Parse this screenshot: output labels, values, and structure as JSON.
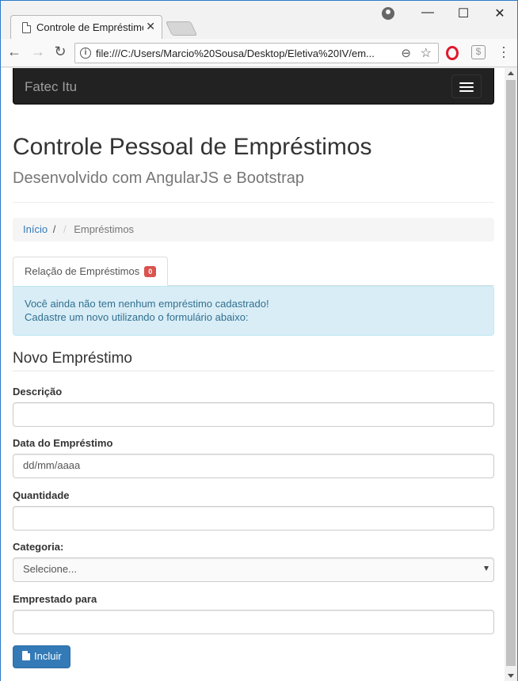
{
  "browser": {
    "tab_title": "Controle de Empréstimos",
    "tab_close": "✕",
    "url": "file:///C:/Users/Marcio%20Sousa/Desktop/Eletiva%20IV/em...",
    "controls": {
      "minimize": "—",
      "maximize": "☐",
      "close": "✕"
    }
  },
  "navbar": {
    "brand": "Fatec Itu"
  },
  "header": {
    "title": "Controle Pessoal de Empréstimos",
    "subtitle": "Desenvolvido com AngularJS e Bootstrap"
  },
  "breadcrumb": {
    "home": "Início",
    "separator": "/",
    "current": "Empréstimos"
  },
  "tabs": [
    {
      "label": "Relação de Empréstimos",
      "badge": "0"
    }
  ],
  "alert": {
    "line1": "Você ainda não tem nenhum empréstimo cadastrado!",
    "line2": "Cadastre um novo utilizando o formulário abaixo:"
  },
  "form": {
    "title": "Novo Empréstimo",
    "fields": {
      "descricao": {
        "label": "Descrição",
        "value": ""
      },
      "data": {
        "label": "Data do Empréstimo",
        "value": "dd/mm/aaaa"
      },
      "quantidade": {
        "label": "Quantidade",
        "value": ""
      },
      "categoria": {
        "label": "Categoria:",
        "selected": "Selecione..."
      },
      "emprestado_para": {
        "label": "Emprestado para",
        "value": ""
      }
    },
    "submit_label": "Incluir"
  },
  "colors": {
    "navbar": "#222222",
    "link": "#337ab7",
    "badge": "#d9534f",
    "alert_bg": "#d9edf7",
    "button": "#337ab7"
  }
}
